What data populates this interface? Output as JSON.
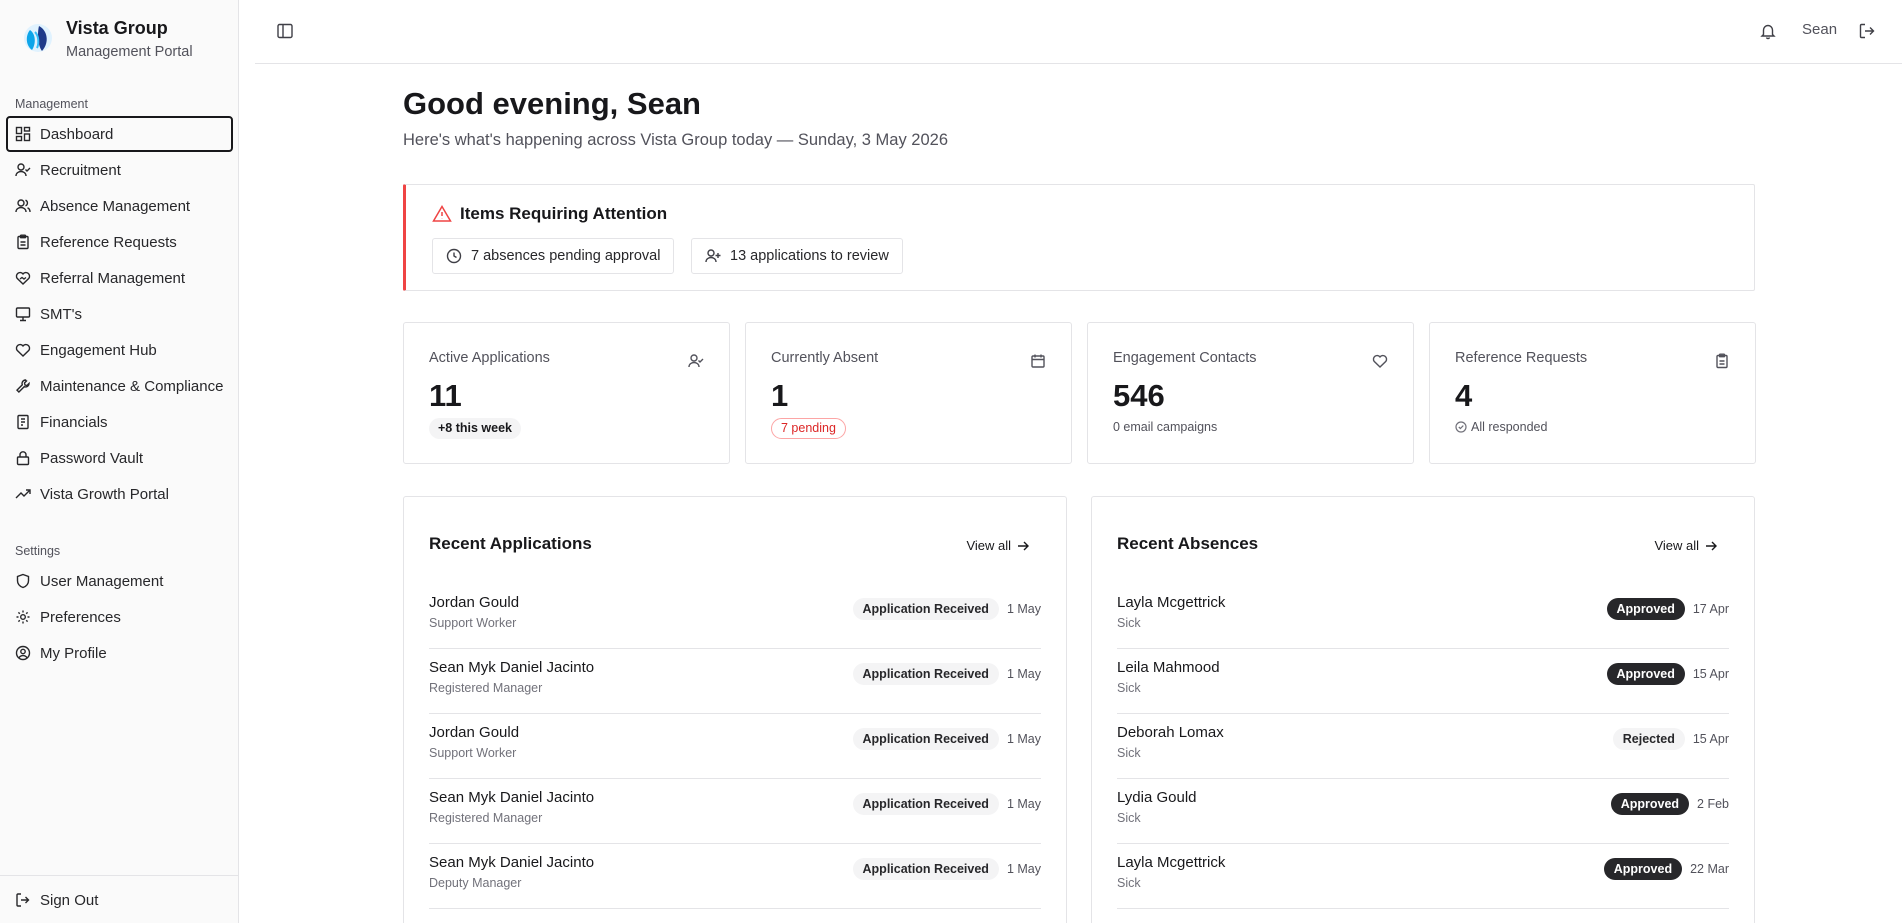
{
  "brand": {
    "name": "Vista Group",
    "subtitle": "Management Portal"
  },
  "sidebar": {
    "management_heading": "Management",
    "management_items": [
      {
        "label": "Dashboard",
        "icon": "dashboard-icon",
        "active": true
      },
      {
        "label": "Recruitment",
        "icon": "user-check-icon"
      },
      {
        "label": "Absence Management",
        "icon": "users-icon"
      },
      {
        "label": "Reference Requests",
        "icon": "clipboard-icon"
      },
      {
        "label": "Referral Management",
        "icon": "handshake-heart-icon"
      },
      {
        "label": "SMT's",
        "icon": "presentation-icon"
      },
      {
        "label": "Engagement Hub",
        "icon": "heart-icon"
      },
      {
        "label": "Maintenance & Compliance",
        "icon": "wrench-icon"
      },
      {
        "label": "Financials",
        "icon": "receipt-icon"
      },
      {
        "label": "Password Vault",
        "icon": "lock-icon"
      },
      {
        "label": "Vista Growth Portal",
        "icon": "trending-up-icon"
      }
    ],
    "settings_heading": "Settings",
    "settings_items": [
      {
        "label": "User Management",
        "icon": "shield-icon"
      },
      {
        "label": "Preferences",
        "icon": "gear-icon"
      },
      {
        "label": "My Profile",
        "icon": "user-circle-icon"
      }
    ],
    "sign_out": "Sign Out"
  },
  "topbar": {
    "user": "Sean"
  },
  "main": {
    "greeting": "Good evening, Sean",
    "subtitle": "Here's what's happening across Vista Group today — Sunday, 3 May 2026",
    "attention": {
      "title": "Items Requiring Attention",
      "chips": [
        "7 absences pending approval",
        "13 applications to review"
      ]
    },
    "stats": [
      {
        "label": "Active Applications",
        "value": "11",
        "badge": "+8 this week",
        "icon": "user-check-icon"
      },
      {
        "label": "Currently Absent",
        "value": "1",
        "badge": "7 pending",
        "icon": "calendar-icon"
      },
      {
        "label": "Engagement Contacts",
        "value": "546",
        "note": "0 email campaigns",
        "icon": "heart-icon"
      },
      {
        "label": "Reference Requests",
        "value": "4",
        "note": "All responded",
        "icon": "clipboard-icon"
      }
    ],
    "recent_applications": {
      "title": "Recent Applications",
      "view_all": "View all",
      "rows": [
        {
          "name": "Jordan Gould",
          "role": "Support Worker",
          "status": "Application Received",
          "date": "1 May"
        },
        {
          "name": "Sean Myk Daniel Jacinto",
          "role": "Registered Manager",
          "status": "Application Received",
          "date": "1 May"
        },
        {
          "name": "Jordan Gould",
          "role": "Support Worker",
          "status": "Application Received",
          "date": "1 May"
        },
        {
          "name": "Sean Myk Daniel Jacinto",
          "role": "Registered Manager",
          "status": "Application Received",
          "date": "1 May"
        },
        {
          "name": "Sean Myk Daniel Jacinto",
          "role": "Deputy Manager",
          "status": "Application Received",
          "date": "1 May"
        }
      ]
    },
    "recent_absences": {
      "title": "Recent Absences",
      "view_all": "View all",
      "rows": [
        {
          "name": "Layla Mcgettrick",
          "type": "Sick",
          "status": "Approved",
          "date": "17 Apr"
        },
        {
          "name": "Leila Mahmood",
          "type": "Sick",
          "status": "Approved",
          "date": "15 Apr"
        },
        {
          "name": "Deborah Lomax",
          "type": "Sick",
          "status": "Rejected",
          "date": "15 Apr"
        },
        {
          "name": "Lydia Gould",
          "type": "Sick",
          "status": "Approved",
          "date": "2 Feb"
        },
        {
          "name": "Layla Mcgettrick",
          "type": "Sick",
          "status": "Approved",
          "date": "22 Mar"
        }
      ]
    }
  },
  "colors": {
    "accent_red": "#ef4444",
    "dark_pill": "#27272a",
    "border": "#e4e4e7"
  }
}
